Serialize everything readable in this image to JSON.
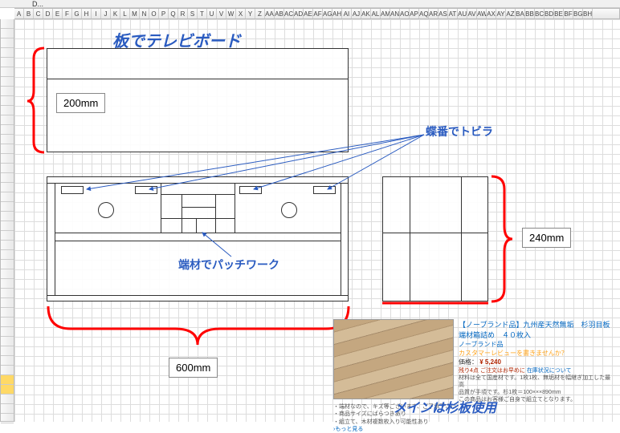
{
  "cellref": "D...",
  "title": "板でテレビボード",
  "dims": {
    "height1": "200mm",
    "height2": "240mm",
    "width": "600mm"
  },
  "annotations": {
    "hinge": "蝶番でトビラ",
    "patchwork": "端材でパッチワーク",
    "materials": "メインは杉板使用"
  },
  "product": {
    "title": "【ノーブランド品】九州産天然無垢　杉羽目板　端材箱詰め　４０枚入",
    "brand": "ノーブランド品",
    "stars": "カスタマーレビューを書きませんか？",
    "price_label": "価格：",
    "price": "¥ 5,240",
    "stock": "残り4点",
    "stock_note": "ご注文はお早めに",
    "stock_suffix": "在庫状況について",
    "desc1": "材料は全て国産材です。1枚1枚、無垢材を幅継ぎ加工した最高",
    "desc2": "品質が手頃です。杉1枚＝100×××890mm",
    "desc3": "この商品はお客様ご自身で組立てとなります。",
    "desc4": "・端材なので、キズ等ございます、ご了承下さい",
    "desc5": "・商品サイズにばらつきあり",
    "desc6": "・組立て、木材複数枚入り可能性あり",
    "more": "›もっと見る"
  },
  "cols": [
    "A",
    "B",
    "C",
    "D",
    "E",
    "F",
    "G",
    "H",
    "I",
    "J",
    "K",
    "L",
    "M",
    "N",
    "O",
    "P",
    "Q",
    "R",
    "S",
    "T",
    "U",
    "V",
    "W",
    "X",
    "Y",
    "Z",
    "AA",
    "AB",
    "AC",
    "AD",
    "AE",
    "AF",
    "AG",
    "AH",
    "AI",
    "AJ",
    "AK",
    "AL",
    "AM",
    "AN",
    "AO",
    "AP",
    "AQ",
    "AR",
    "AS",
    "AT",
    "AU",
    "AV",
    "AW",
    "AX",
    "AY",
    "AZ",
    "BA",
    "BB",
    "BC",
    "BD",
    "BE",
    "BF",
    "BG",
    "BH"
  ]
}
